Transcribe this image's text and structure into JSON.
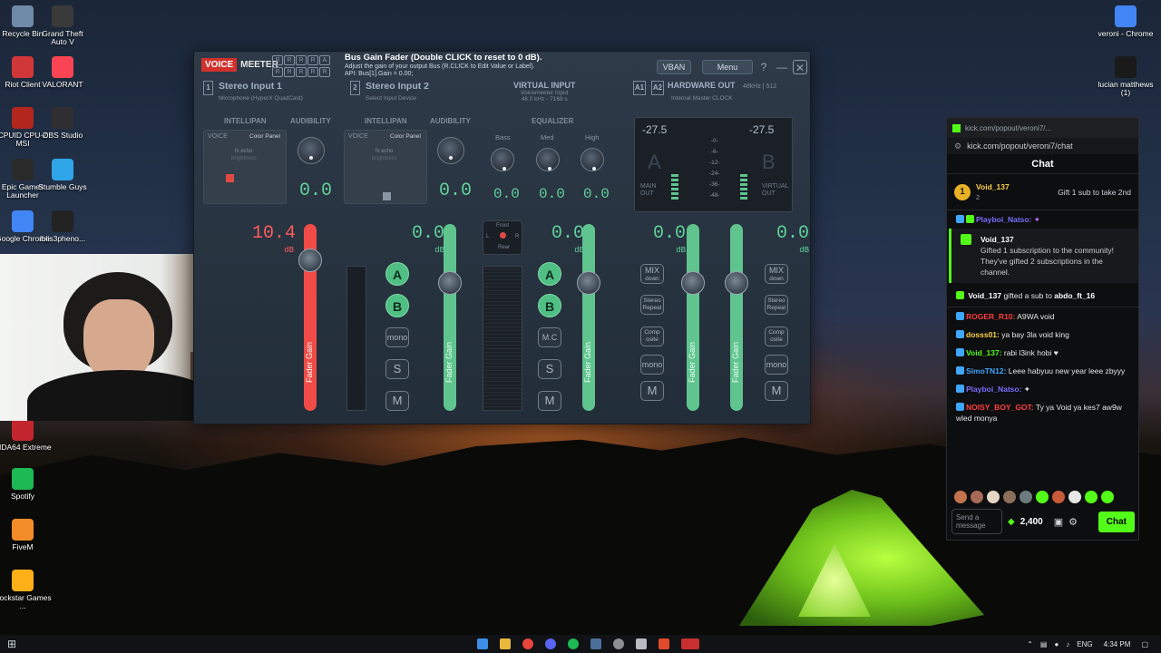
{
  "desktop": {
    "left_icons": [
      {
        "label": "Recycle Bin",
        "color": "#6f8aa6"
      },
      {
        "label": "Grand Theft Auto V",
        "color": "#3a3a3a"
      },
      {
        "label": "Riot Client",
        "color": "#d13639"
      },
      {
        "label": "VALORANT",
        "color": "#fa4454"
      },
      {
        "label": "CPUID CPU-Z MSI",
        "color": "#b3261e"
      },
      {
        "label": "OBS Studio",
        "color": "#302e31"
      },
      {
        "label": "Epic Games Launcher",
        "color": "#2a2a2a"
      },
      {
        "label": "Stumble Guys",
        "color": "#2fa4e7"
      },
      {
        "label": "Google Chrome",
        "color": "#4285f4"
      },
      {
        "label": "iblis3pheno...",
        "color": "#222222"
      },
      {
        "label": "AIDA64 Extreme",
        "color": "#c3262e"
      },
      {
        "label": "Spotify",
        "color": "#1db954"
      },
      {
        "label": "FiveM",
        "color": "#f28c28"
      },
      {
        "label": "Rockstar Games ...",
        "color": "#fcaf17"
      }
    ],
    "right_icons": [
      {
        "label": "veroni - Chrome",
        "color": "#4285f4"
      },
      {
        "label": "lucian matthews (1)",
        "color": "#1a1a1a"
      }
    ]
  },
  "voicemeeter": {
    "logo_voice": "VOICE",
    "logo_meeter": "MEETER",
    "r_grid": [
      "R",
      "R",
      "R",
      "R",
      "A",
      "R",
      "R",
      "R",
      "R",
      "R"
    ],
    "tooltip_title": "Bus Gain Fader (Double CLICK to reset to 0 dB).",
    "tooltip_line1": "Adjust the gain of your output Bus (R.CLICK to Edit Value or Label).",
    "tooltip_line2": "API: Bus[1].Gain = 0.00;",
    "vban_label": "VBAN",
    "menu_label": "Menu",
    "help_label": "?",
    "minimize_label": "—",
    "close_label": "✕",
    "strip1": {
      "num": "1",
      "name": "Stereo Input 1",
      "device": "Microphone (HyperX QuadCast)"
    },
    "strip2": {
      "num": "2",
      "name": "Stereo Input 2",
      "device": "Select Input Device"
    },
    "virtual": {
      "name": "VIRTUAL INPUT",
      "device": "Voicemeeter Input",
      "info": "48.0 kHz - 7168 s"
    },
    "hardware": {
      "a1": "A1",
      "a2": "A2",
      "name": "HARDWARE OUT",
      "rate": "48kHz | 512",
      "device": "Internal Master CLOCK"
    },
    "intellipan": "INTELLIPAN",
    "audibility": "AUDIBILITY",
    "voice": "VOICE",
    "color_panel": "Color Panel",
    "fx_echo": "fx echo",
    "brightness": "brightness",
    "equalizer": "EQUALIZER",
    "bass": "Bass",
    "med": "Med",
    "high": "High",
    "knob1_val": "0.0",
    "knob2_val": "0.0",
    "eq_bass": "0.0",
    "eq_med": "0.0",
    "eq_high": "0.0",
    "hw_db_left": "-27.5",
    "hw_db_right": "-27.5",
    "db_unit": "dB",
    "hw_scale": [
      "-0-",
      "-6-",
      "-12-",
      "-24-",
      "-36-",
      "-48-"
    ],
    "main_out": "MAIN OUT",
    "virtual_out": "VIRTUAL OUT",
    "faders": [
      {
        "db": "10.4",
        "label": "Fader Gain",
        "level": 0.87,
        "red": true
      },
      {
        "db": "0.0",
        "label": "Fader Gain",
        "level": 0.75,
        "red": false
      },
      {
        "db": "0.0",
        "label": "Fader Gain",
        "level": 0.75,
        "red": false
      },
      {
        "db": "0.0",
        "label": "Fader Gain",
        "level": 0.75,
        "red": false
      },
      {
        "db": "0.0",
        "label": "Fader Gain",
        "level": 0.75,
        "red": false
      }
    ],
    "btn_a": "A",
    "btn_b": "B",
    "mono": "mono",
    "solo": "S",
    "mute": "M",
    "mc": "M.C",
    "mix": "MIX",
    "down": "down",
    "stereo": "Stereo",
    "repeat": "Repeat",
    "comp": "Comp",
    "osite": "osite",
    "front": "Front",
    "rear": "Rear",
    "l": "L",
    "r": "R"
  },
  "chat": {
    "window_url": "kick.com/popout/veroni7/...",
    "url": "kick.com/popout/veroni7/chat",
    "title": "Chat",
    "pinned_user": "Void_137",
    "pinned_count": "1",
    "pinned_sub": "2",
    "pinned_text": "Gift 1 sub to take 2nd",
    "messages_top": [
      {
        "user": "Playboi_Natso:",
        "text": "",
        "color": "#7b6cff"
      }
    ],
    "gift_user": "Void_137",
    "gift_text": "Gifted 1 subscription to the community! They've gifted 2 subscriptions in the channel.",
    "gift2_user": "Void_137",
    "gift2_text": "gifted a sub to",
    "gift2_target": "abdo_ft_16",
    "messages": [
      {
        "user": "ROGER_R10:",
        "text": " A9WA void",
        "color": "#ff3b3b"
      },
      {
        "user": "dosss01:",
        "text": " ya bay 3la void king",
        "color": "#ffd04a"
      },
      {
        "user": "Void_137:",
        "text": " rabi l3ink hobi ♥",
        "color": "#53fc18"
      },
      {
        "user": "SimoTN12:",
        "text": " Leee habyuu new year leee zbyyy",
        "color": "#3fa7ff"
      },
      {
        "user": "Playboi_Natso:",
        "text": " ✦",
        "color": "#7b6cff"
      },
      {
        "user": "NOISY_BOY_GOT:",
        "text": " Ty ya Void ya kes7 aw9w wled monya",
        "color": "#ff4141"
      }
    ],
    "input_placeholder": "Send a message",
    "points": "2,400",
    "send_label": "Chat"
  },
  "taskbar": {
    "lang": "ENG",
    "time": "4:34 PM"
  }
}
